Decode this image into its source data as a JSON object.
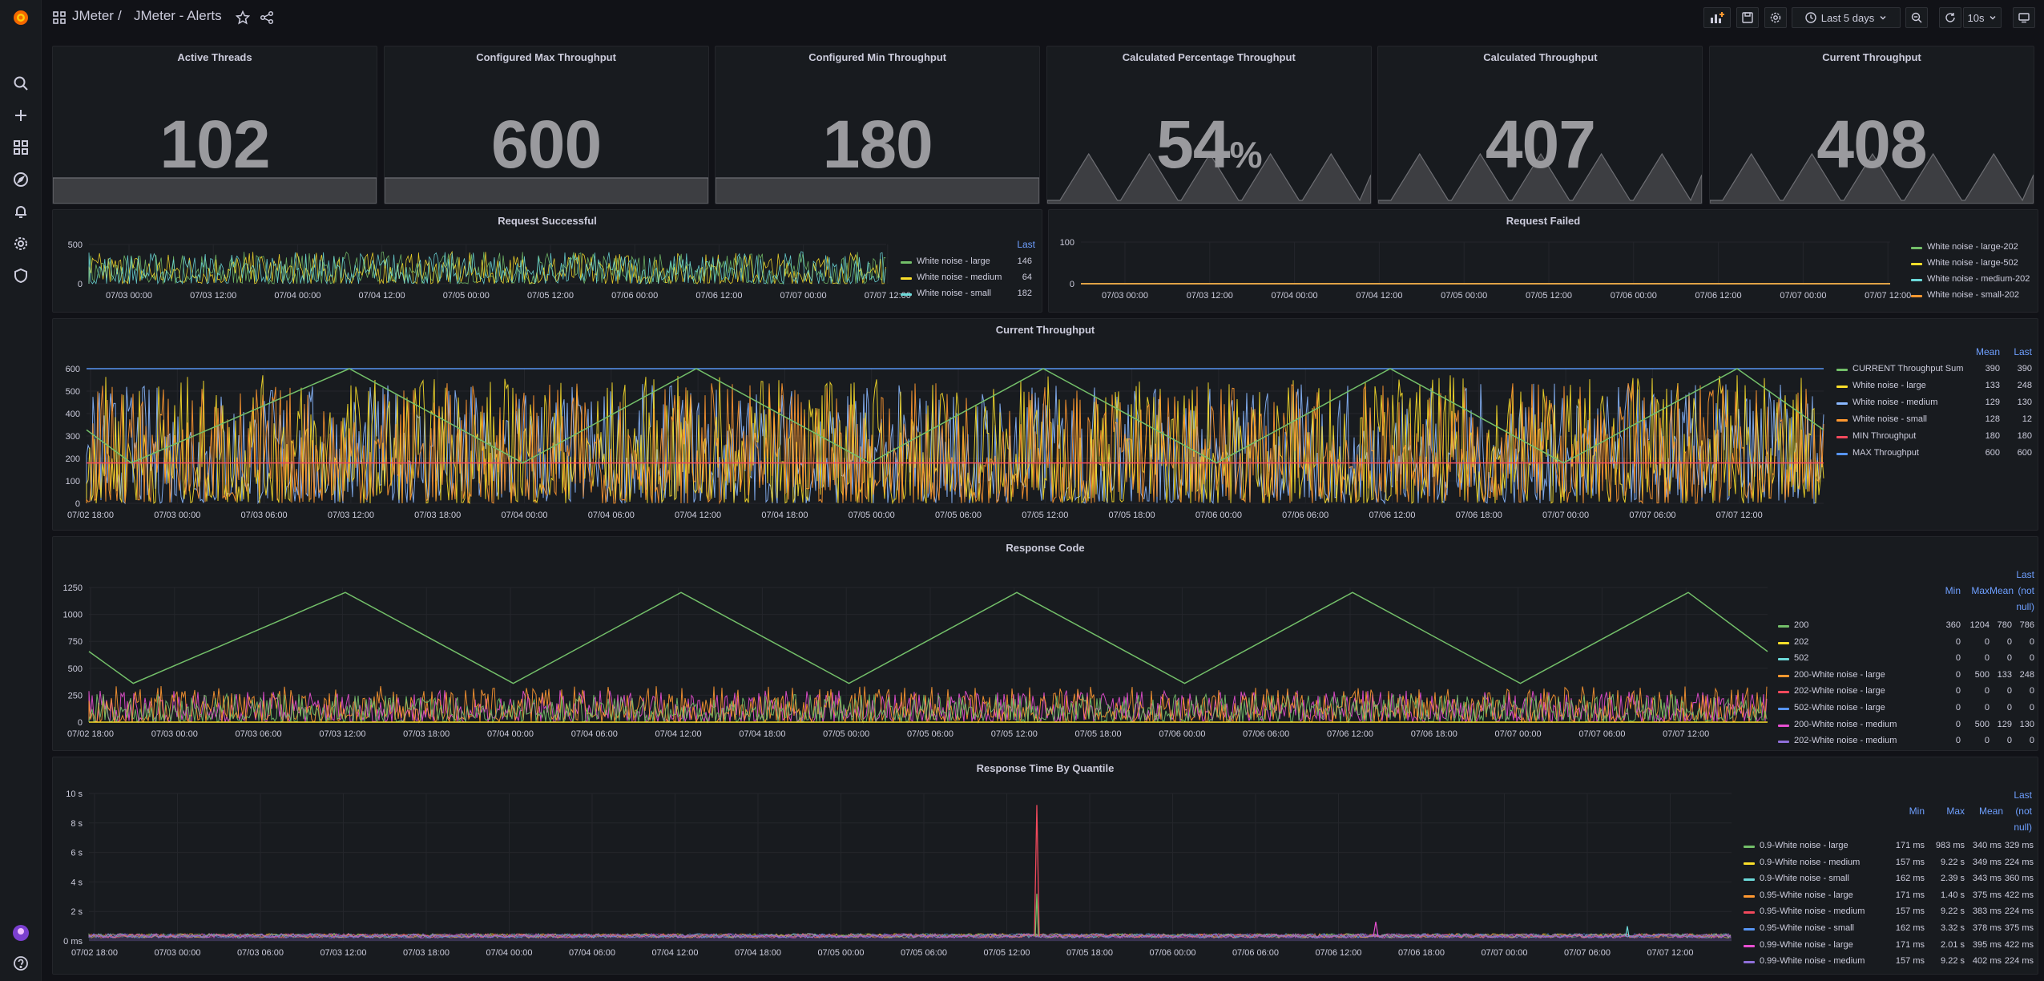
{
  "nav": {
    "breadcrumb_folder": "JMeter",
    "breadcrumb_sep": "/",
    "breadcrumb_dashboard": "JMeter - Alerts",
    "time_range": "Last 5 days",
    "refresh_interval": "10s"
  },
  "sidebar_icons": [
    "grafana-logo-icon",
    "search-icon",
    "plus-icon",
    "dashboards-icon",
    "explore-icon",
    "alerting-icon",
    "configuration-icon",
    "shield-icon",
    "user-avatar-icon",
    "help-icon"
  ],
  "stats": [
    {
      "title": "Active Threads",
      "value": "102",
      "unit": ""
    },
    {
      "title": "Configured Max Throughput",
      "value": "600",
      "unit": ""
    },
    {
      "title": "Configured Min Throughput",
      "value": "180",
      "unit": ""
    },
    {
      "title": "Calculated Percentage Throughput",
      "value": "54",
      "unit": "%"
    },
    {
      "title": "Calculated Throughput",
      "value": "407",
      "unit": ""
    },
    {
      "title": "Current Throughput",
      "value": "408",
      "unit": ""
    }
  ],
  "colors": {
    "green": "#73bf69",
    "yellow": "#fade2a",
    "cyan": "#8ab8ff",
    "lightblue": "#5794f2",
    "orange": "#ff9830",
    "red": "#f2495c",
    "blue": "#5794f2",
    "purple": "#b877d9",
    "pink": "#e84fd1",
    "teal": "#6cd9d9",
    "sparkline": "#6d6e73"
  },
  "request_successful": {
    "title": "Request Successful",
    "legend_header": "Last",
    "y_ticks": [
      "500",
      "0"
    ],
    "x_ticks": [
      "07/03 00:00",
      "07/03 12:00",
      "07/04 00:00",
      "07/04 12:00",
      "07/05 00:00",
      "07/05 12:00",
      "07/06 00:00",
      "07/06 12:00",
      "07/07 00:00",
      "07/07 12:00"
    ],
    "series": [
      {
        "name": "White noise - large",
        "last": "146",
        "color": "#73bf69"
      },
      {
        "name": "White noise - medium",
        "last": "64",
        "color": "#fade2a"
      },
      {
        "name": "White noise - small",
        "last": "182",
        "color": "#6cd9d9"
      }
    ]
  },
  "request_failed": {
    "title": "Request Failed",
    "y_ticks": [
      "100",
      "0"
    ],
    "x_ticks": [
      "07/03 00:00",
      "07/03 12:00",
      "07/04 00:00",
      "07/04 12:00",
      "07/05 00:00",
      "07/05 12:00",
      "07/06 00:00",
      "07/06 12:00",
      "07/07 00:00",
      "07/07 12:00"
    ],
    "series": [
      {
        "name": "White noise - large-202",
        "color": "#73bf69"
      },
      {
        "name": "White noise - large-502",
        "color": "#fade2a"
      },
      {
        "name": "White noise - medium-202",
        "color": "#6cd9d9"
      },
      {
        "name": "White noise - small-202",
        "color": "#ff9830"
      }
    ]
  },
  "current_throughput": {
    "title": "Current Throughput",
    "headers": [
      "Mean",
      "Last"
    ],
    "y_ticks": [
      "600",
      "500",
      "400",
      "300",
      "200",
      "100",
      "0"
    ],
    "x_ticks": [
      "07/02 18:00",
      "07/03 00:00",
      "07/03 06:00",
      "07/03 12:00",
      "07/03 18:00",
      "07/04 00:00",
      "07/04 06:00",
      "07/04 12:00",
      "07/04 18:00",
      "07/05 00:00",
      "07/05 06:00",
      "07/05 12:00",
      "07/05 18:00",
      "07/06 00:00",
      "07/06 06:00",
      "07/06 12:00",
      "07/06 18:00",
      "07/07 00:00",
      "07/07 06:00",
      "07/07 12:00"
    ],
    "series": [
      {
        "name": "CURRENT Throughput Sum",
        "mean": "390",
        "last": "390",
        "color": "#73bf69"
      },
      {
        "name": "White noise - large",
        "mean": "133",
        "last": "248",
        "color": "#fade2a"
      },
      {
        "name": "White noise - medium",
        "mean": "129",
        "last": "130",
        "color": "#8ab8ff"
      },
      {
        "name": "White noise - small",
        "mean": "128",
        "last": "12",
        "color": "#ff9830"
      },
      {
        "name": "MIN Throughput",
        "mean": "180",
        "last": "180",
        "color": "#f2495c"
      },
      {
        "name": "MAX Throughput",
        "mean": "600",
        "last": "600",
        "color": "#5794f2"
      }
    ]
  },
  "response_code": {
    "title": "Response Code",
    "headers": [
      "Min",
      "Max",
      "Mean",
      "Last",
      "(not",
      "null)"
    ],
    "y_ticks": [
      "1250",
      "1000",
      "750",
      "500",
      "250",
      "0"
    ],
    "x_ticks": [
      "07/02 18:00",
      "07/03 00:00",
      "07/03 06:00",
      "07/03 12:00",
      "07/03 18:00",
      "07/04 00:00",
      "07/04 06:00",
      "07/04 12:00",
      "07/04 18:00",
      "07/05 00:00",
      "07/05 06:00",
      "07/05 12:00",
      "07/05 18:00",
      "07/06 00:00",
      "07/06 06:00",
      "07/06 12:00",
      "07/06 18:00",
      "07/07 00:00",
      "07/07 06:00",
      "07/07 12:00"
    ],
    "series": [
      {
        "name": "200",
        "min": "360",
        "max": "1204",
        "mean": "780",
        "last": "786",
        "color": "#73bf69"
      },
      {
        "name": "202",
        "min": "0",
        "max": "0",
        "mean": "0",
        "last": "0",
        "color": "#fade2a"
      },
      {
        "name": "502",
        "min": "0",
        "max": "0",
        "mean": "0",
        "last": "0",
        "color": "#6cd9d9"
      },
      {
        "name": "200-White noise - large",
        "min": "0",
        "max": "500",
        "mean": "133",
        "last": "248",
        "color": "#ff9830"
      },
      {
        "name": "202-White noise - large",
        "min": "0",
        "max": "0",
        "mean": "0",
        "last": "0",
        "color": "#f2495c"
      },
      {
        "name": "502-White noise - large",
        "min": "0",
        "max": "0",
        "mean": "0",
        "last": "0",
        "color": "#5794f2"
      },
      {
        "name": "200-White noise - medium",
        "min": "0",
        "max": "500",
        "mean": "129",
        "last": "130",
        "color": "#e84fd1"
      },
      {
        "name": "202-White noise - medium",
        "min": "0",
        "max": "0",
        "mean": "0",
        "last": "0",
        "color": "#8f6fd9"
      }
    ]
  },
  "response_time": {
    "title": "Response Time By Quantile",
    "headers": [
      "Min",
      "Max",
      "Mean",
      "Last",
      "(not",
      "null)"
    ],
    "y_ticks": [
      "10 s",
      "8 s",
      "6 s",
      "4 s",
      "2 s",
      "0 ms"
    ],
    "x_ticks": [
      "07/02 18:00",
      "07/03 00:00",
      "07/03 06:00",
      "07/03 12:00",
      "07/03 18:00",
      "07/04 00:00",
      "07/04 06:00",
      "07/04 12:00",
      "07/04 18:00",
      "07/05 00:00",
      "07/05 06:00",
      "07/05 12:00",
      "07/05 18:00",
      "07/06 00:00",
      "07/06 06:00",
      "07/06 12:00",
      "07/06 18:00",
      "07/07 00:00",
      "07/07 06:00",
      "07/07 12:00"
    ],
    "series": [
      {
        "name": "0.9-White noise - large",
        "min": "171 ms",
        "max": "983 ms",
        "mean": "340 ms",
        "last": "329 ms",
        "color": "#73bf69"
      },
      {
        "name": "0.9-White noise - medium",
        "min": "157 ms",
        "max": "9.22 s",
        "mean": "349 ms",
        "last": "224 ms",
        "color": "#fade2a"
      },
      {
        "name": "0.9-White noise - small",
        "min": "162 ms",
        "max": "2.39 s",
        "mean": "343 ms",
        "last": "360 ms",
        "color": "#6cd9d9"
      },
      {
        "name": "0.95-White noise - large",
        "min": "171 ms",
        "max": "1.40 s",
        "mean": "375 ms",
        "last": "422 ms",
        "color": "#ff9830"
      },
      {
        "name": "0.95-White noise - medium",
        "min": "157 ms",
        "max": "9.22 s",
        "mean": "383 ms",
        "last": "224 ms",
        "color": "#f2495c"
      },
      {
        "name": "0.95-White noise - small",
        "min": "162 ms",
        "max": "3.32 s",
        "mean": "378 ms",
        "last": "375 ms",
        "color": "#5794f2"
      },
      {
        "name": "0.99-White noise - large",
        "min": "171 ms",
        "max": "2.01 s",
        "mean": "395 ms",
        "last": "422 ms",
        "color": "#e84fd1"
      },
      {
        "name": "0.99-White noise - medium",
        "min": "157 ms",
        "max": "9.22 s",
        "mean": "402 ms",
        "last": "224 ms",
        "color": "#8f6fd9"
      }
    ]
  }
}
